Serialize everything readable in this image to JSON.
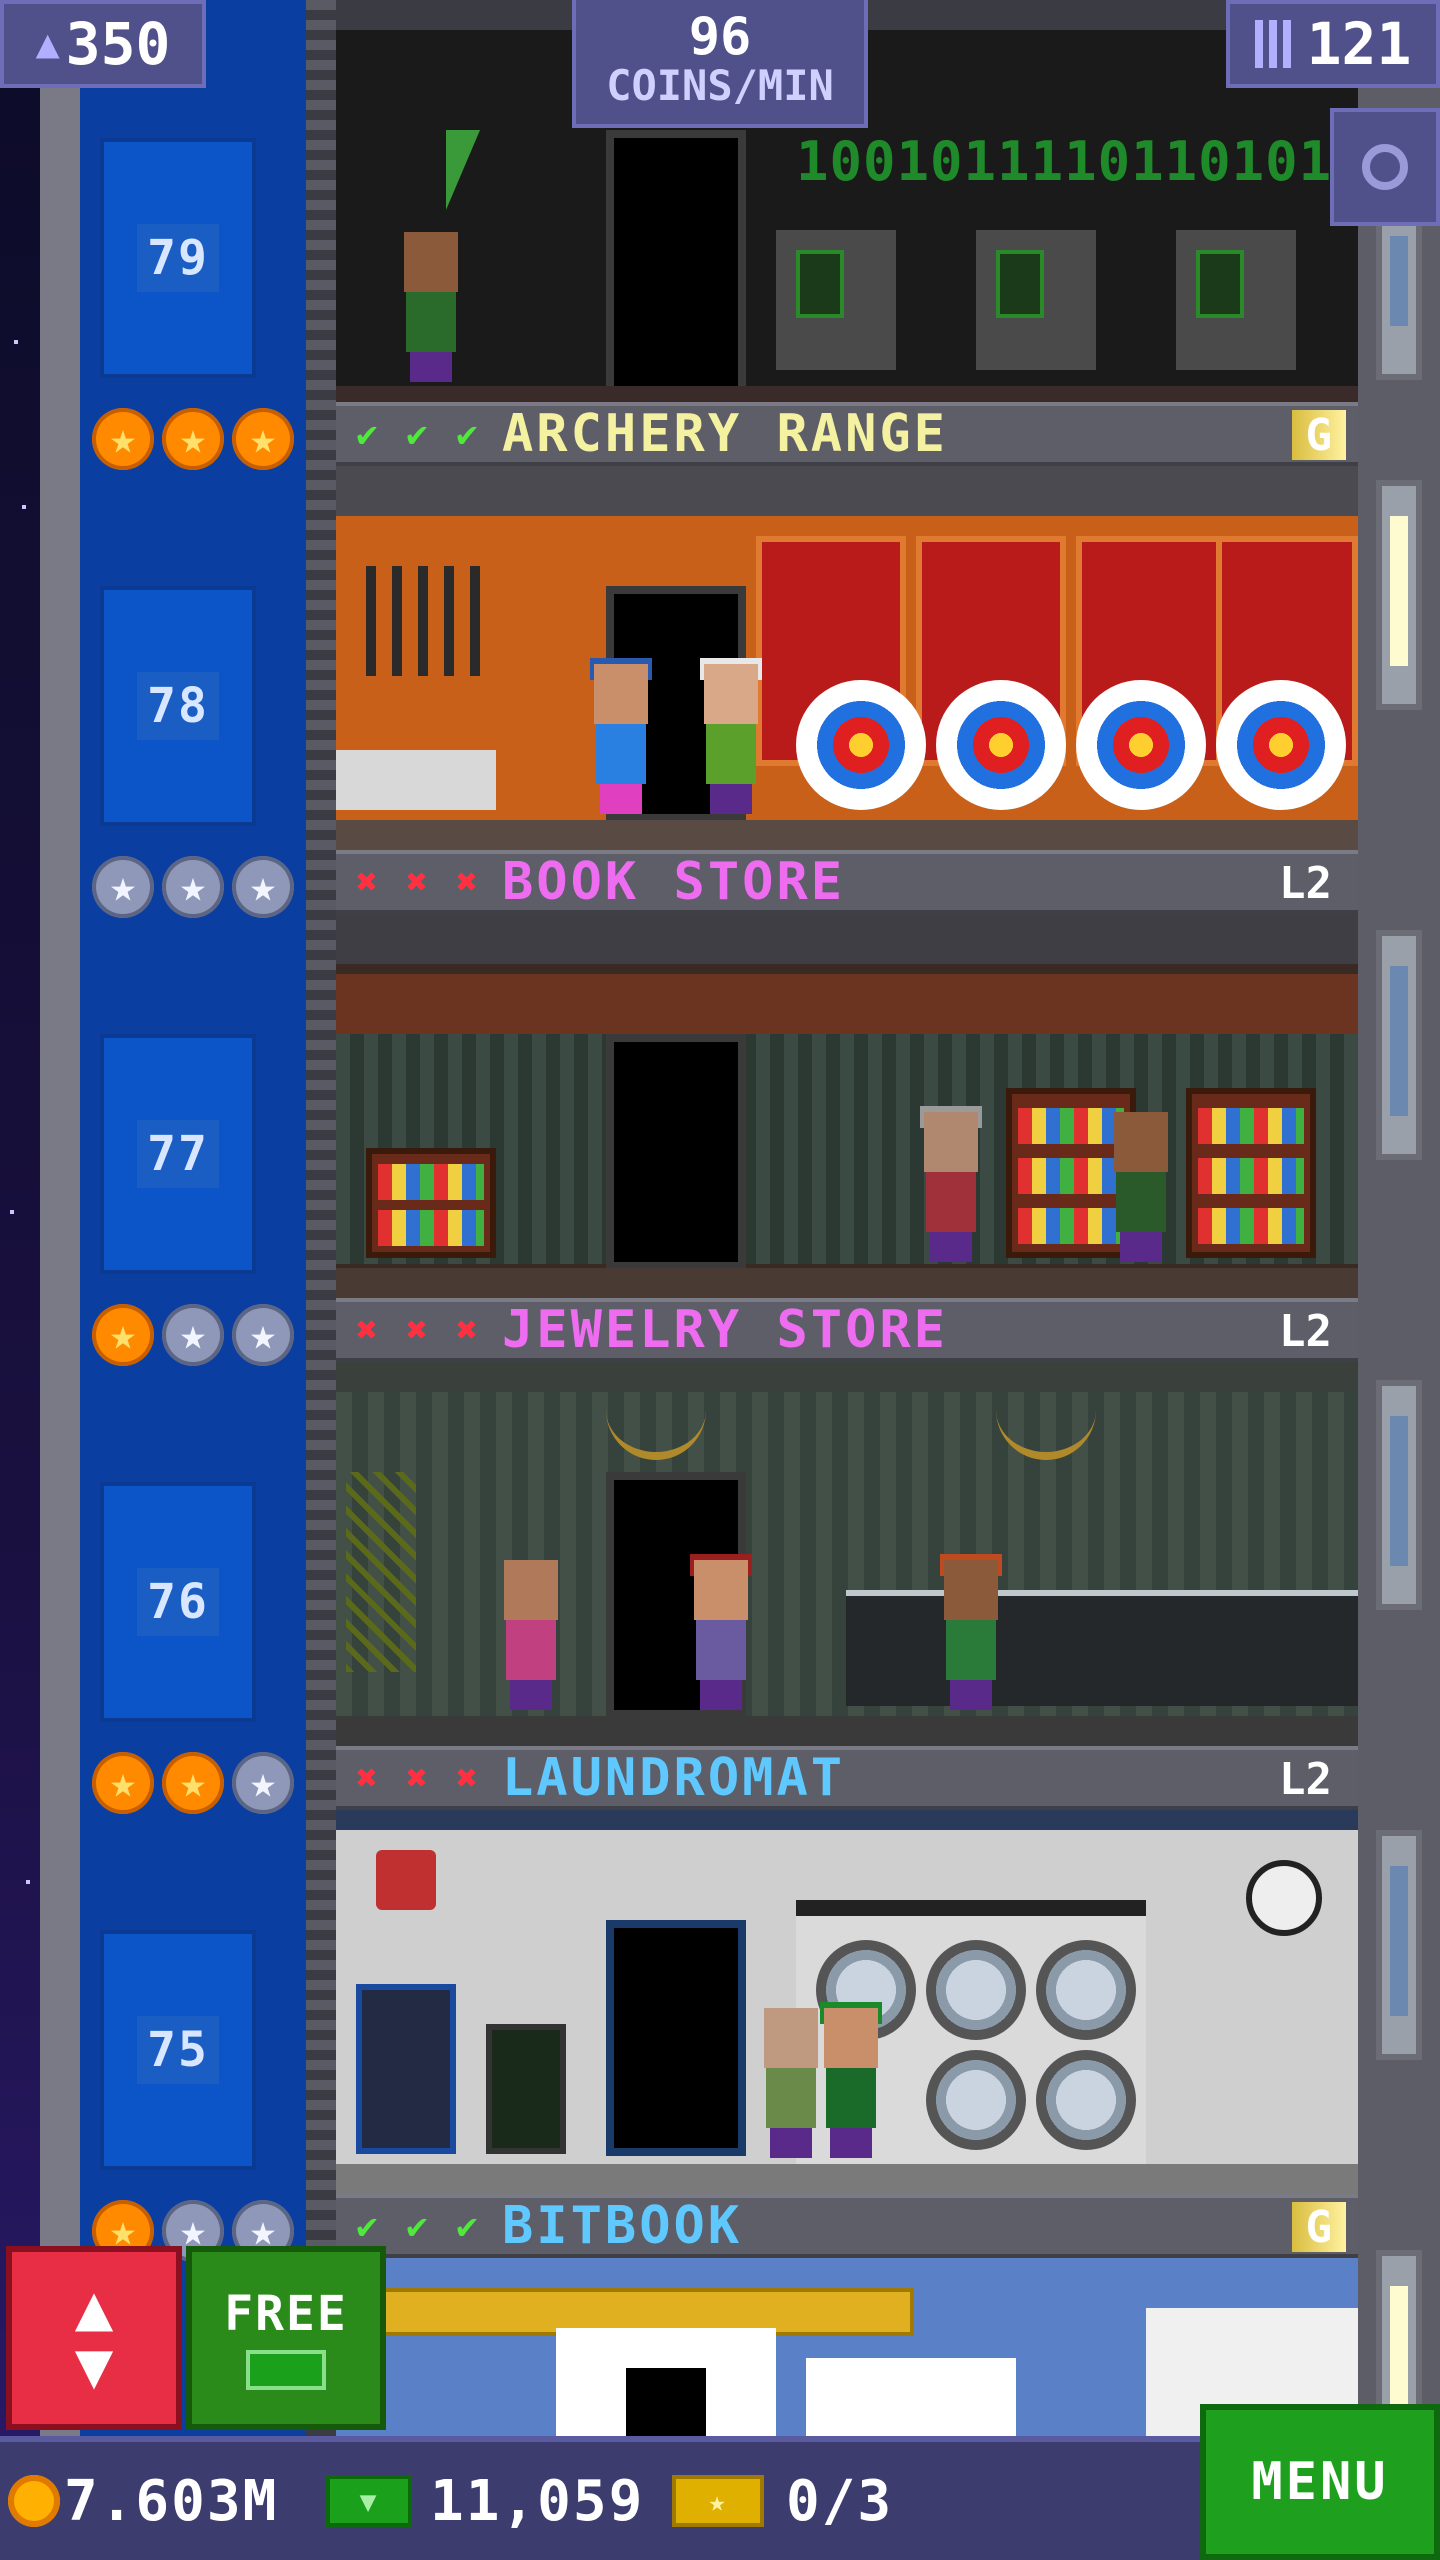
{
  "hud": {
    "population": "350",
    "population_icon": "people-icon",
    "coins_rate_value": "96",
    "coins_rate_label": "COINS/MIN",
    "floors_count": "121",
    "floors_icon": "building-icon",
    "search_icon": "magnifier-icon"
  },
  "floors": [
    {
      "number": "79"
    },
    {
      "number": "78"
    },
    {
      "number": "77"
    },
    {
      "number": "76"
    },
    {
      "number": "75"
    }
  ],
  "top_room": {
    "binary_text": "1001011110110101"
  },
  "businesses": [
    {
      "name": "ARCHERY RANGE",
      "name_color": "#f4f2a0",
      "badge": "G",
      "badge_style": "gold",
      "stock": [
        "ok",
        "ok",
        "ok"
      ],
      "stars": [
        "gold",
        "gold",
        "gold"
      ]
    },
    {
      "name": "BOOK STORE",
      "name_color": "#ee6cf0",
      "badge": "L2",
      "badge_style": "plain",
      "stock": [
        "no",
        "no",
        "no"
      ],
      "stars": [
        "silver",
        "silver",
        "silver"
      ]
    },
    {
      "name": "JEWELRY STORE",
      "name_color": "#ee6cf0",
      "badge": "L2",
      "badge_style": "plain",
      "stock": [
        "no",
        "no",
        "no"
      ],
      "stars": [
        "gold",
        "silver",
        "silver"
      ]
    },
    {
      "name": "LAUNDROMAT",
      "name_color": "#5fc8ff",
      "badge": "L2",
      "badge_style": "plain",
      "stock": [
        "no",
        "no",
        "no"
      ],
      "stars": [
        "gold",
        "gold",
        "silver"
      ]
    },
    {
      "name": "BITBOOK",
      "name_color": "#5fc8ff",
      "badge": "G",
      "badge_style": "gold",
      "stock": [
        "ok",
        "ok",
        "ok"
      ],
      "stars": [
        "gold",
        "silver",
        "silver"
      ]
    }
  ],
  "buttons": {
    "elevator_icon": "up-down-arrows-icon",
    "free_label": "FREE",
    "menu_label": "MENU"
  },
  "currency": {
    "coins": "7.603M",
    "bux": "11,059",
    "tickets": "0/3"
  }
}
